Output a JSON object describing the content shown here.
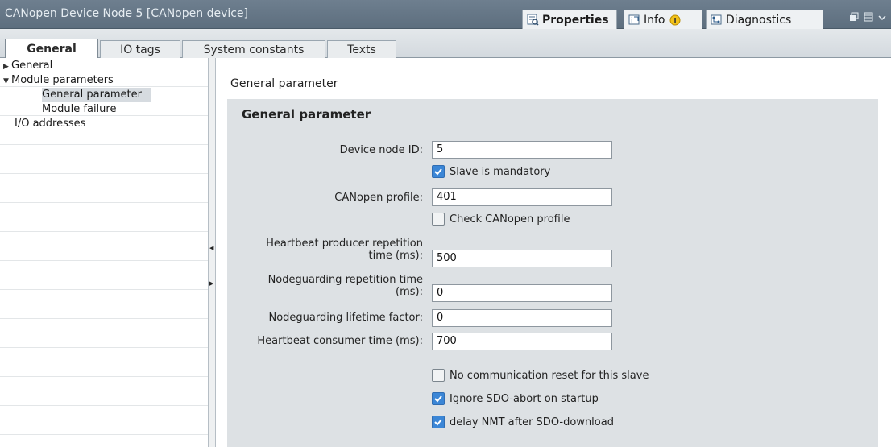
{
  "window": {
    "title": "CANopen Device Node 5 [CANopen device]",
    "tabs": [
      {
        "label": "Properties",
        "icon": "properties-icon"
      },
      {
        "label": "Info",
        "icon": "info-icon"
      },
      {
        "label": "Diagnostics",
        "icon": "diagnostics-icon"
      }
    ]
  },
  "tabs": [
    "General",
    "IO tags",
    "System constants",
    "Texts"
  ],
  "nav": {
    "items": [
      "General",
      "Module parameters",
      "General parameter",
      "Module failure",
      "I/O addresses"
    ]
  },
  "main": {
    "section_title": "General parameter",
    "panel_heading": "General parameter",
    "fields": {
      "device_node_id": {
        "label": "Device node ID:",
        "value": "5"
      },
      "canopen_profile": {
        "label": "CANopen profile:",
        "value": "401"
      },
      "heartbeat_producer": {
        "label_line1": "Heartbeat producer repetition",
        "label_line2": "time (ms):",
        "value": "500"
      },
      "nodeguarding_rep": {
        "label_line1": "Nodeguarding repetition time",
        "label_line2": "(ms):",
        "value": "0"
      },
      "nodeguarding_lifetime": {
        "label": "Nodeguarding lifetime factor:",
        "value": "0"
      },
      "heartbeat_consumer": {
        "label": "Heartbeat consumer time (ms):",
        "value": "700"
      }
    },
    "checkboxes": {
      "slave_mandatory": {
        "label": "Slave is mandatory",
        "checked": true
      },
      "check_profile": {
        "label": "Check CANopen profile",
        "checked": false
      },
      "no_comm_reset": {
        "label": "No communication reset for this slave",
        "checked": false
      },
      "ignore_sdo_abort": {
        "label": "Ignore SDO-abort on startup",
        "checked": true
      },
      "delay_nmt": {
        "label": "delay NMT after SDO-download",
        "checked": true
      }
    }
  },
  "colors": {
    "accent": "#3b86d6",
    "titlebar": "#5d6e7e",
    "panel": "#dde1e4"
  }
}
